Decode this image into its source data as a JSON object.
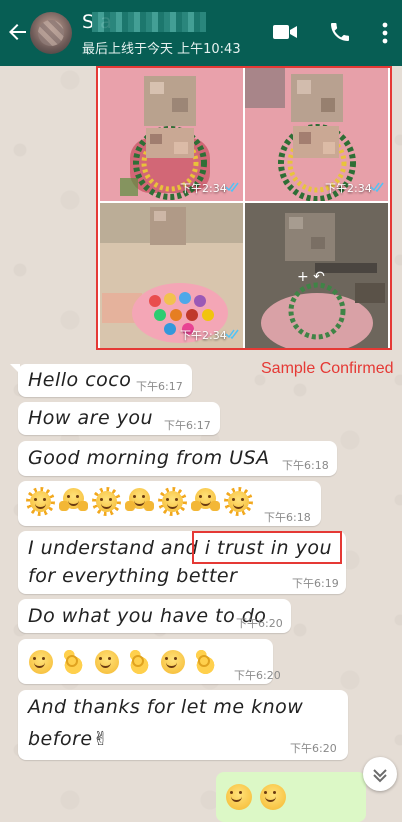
{
  "header": {
    "contact_name": "S      a",
    "last_seen": "最后上线于今天 上午10:43",
    "icons": [
      "back-arrow-icon",
      "video-call-icon",
      "phone-call-icon",
      "more-vertical-icon"
    ]
  },
  "photos": [
    {
      "time": "下午2:34"
    },
    {
      "time": "下午2:34"
    },
    {
      "time": "下午2:34"
    },
    {
      "time": ""
    }
  ],
  "annotation": {
    "sample_label": "Sample Confirmed"
  },
  "messages": [
    {
      "text": "Hello coco",
      "time": "下午6:17"
    },
    {
      "text": "How are you",
      "time": "下午6:17"
    },
    {
      "text": "Good morning from USA",
      "time": "下午6:18"
    },
    {
      "emoji": "sun-hug-row",
      "time": "下午6:18"
    },
    {
      "text_line1": "I understand and i trust in you",
      "text_line2": "for everything better",
      "time": "下午6:19"
    },
    {
      "text": "Do what you have to do",
      "time": "下午6:20"
    },
    {
      "emoji": "smile-ok-row",
      "time": "下午6:20"
    },
    {
      "text_line1": "And thanks for let me know",
      "text_line2": "before✌",
      "time": "下午6:20"
    }
  ],
  "colors": {
    "header": "#075e54",
    "bubble_in": "#ffffff",
    "bubble_out": "#dcf8c6",
    "highlight": "#e53935",
    "read_ticks": "#4fc3f7"
  }
}
